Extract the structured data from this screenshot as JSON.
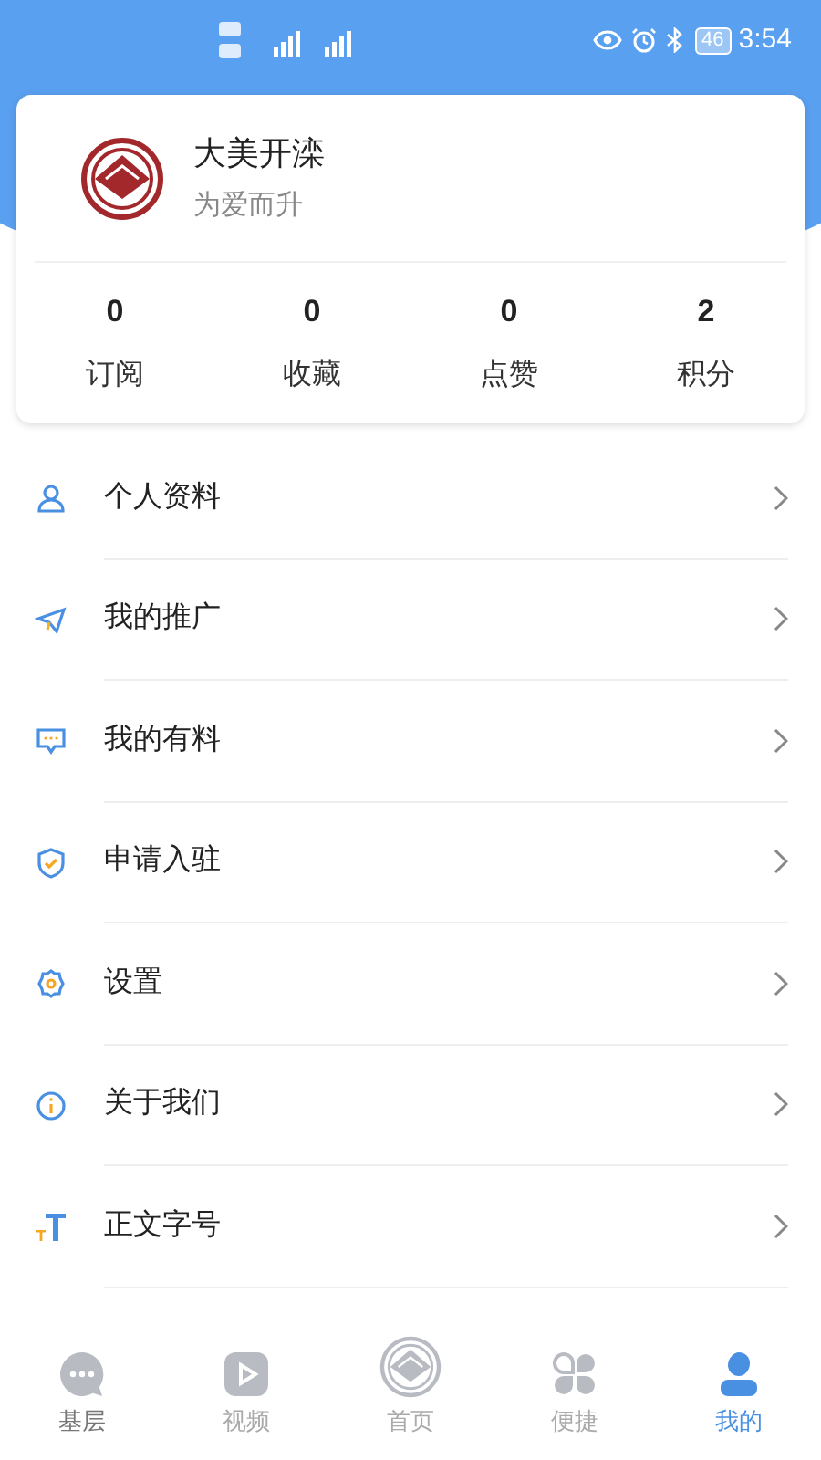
{
  "status_bar": {
    "battery": "46",
    "time": "3:54"
  },
  "profile": {
    "name": "大美开滦",
    "slogan": "为爱而升"
  },
  "stats": [
    {
      "value": "0",
      "label": "订阅"
    },
    {
      "value": "0",
      "label": "收藏"
    },
    {
      "value": "0",
      "label": "点赞"
    },
    {
      "value": "2",
      "label": "积分"
    }
  ],
  "menu": [
    {
      "kind": "profile",
      "label": "个人资料"
    },
    {
      "kind": "promote",
      "label": "我的推广"
    },
    {
      "kind": "posts",
      "label": "我的有料"
    },
    {
      "kind": "apply",
      "label": "申请入驻"
    },
    {
      "kind": "settings",
      "label": "设置"
    },
    {
      "kind": "about",
      "label": "关于我们"
    },
    {
      "kind": "font",
      "label": "正文字号"
    }
  ],
  "tabs": [
    {
      "kind": "community",
      "label": "基层",
      "selected": false
    },
    {
      "kind": "video",
      "label": "视频",
      "selected": false
    },
    {
      "kind": "home",
      "label": "首页",
      "selected": false
    },
    {
      "kind": "shortcuts",
      "label": "便捷",
      "selected": false
    },
    {
      "kind": "me",
      "label": "我的",
      "selected": true
    }
  ]
}
